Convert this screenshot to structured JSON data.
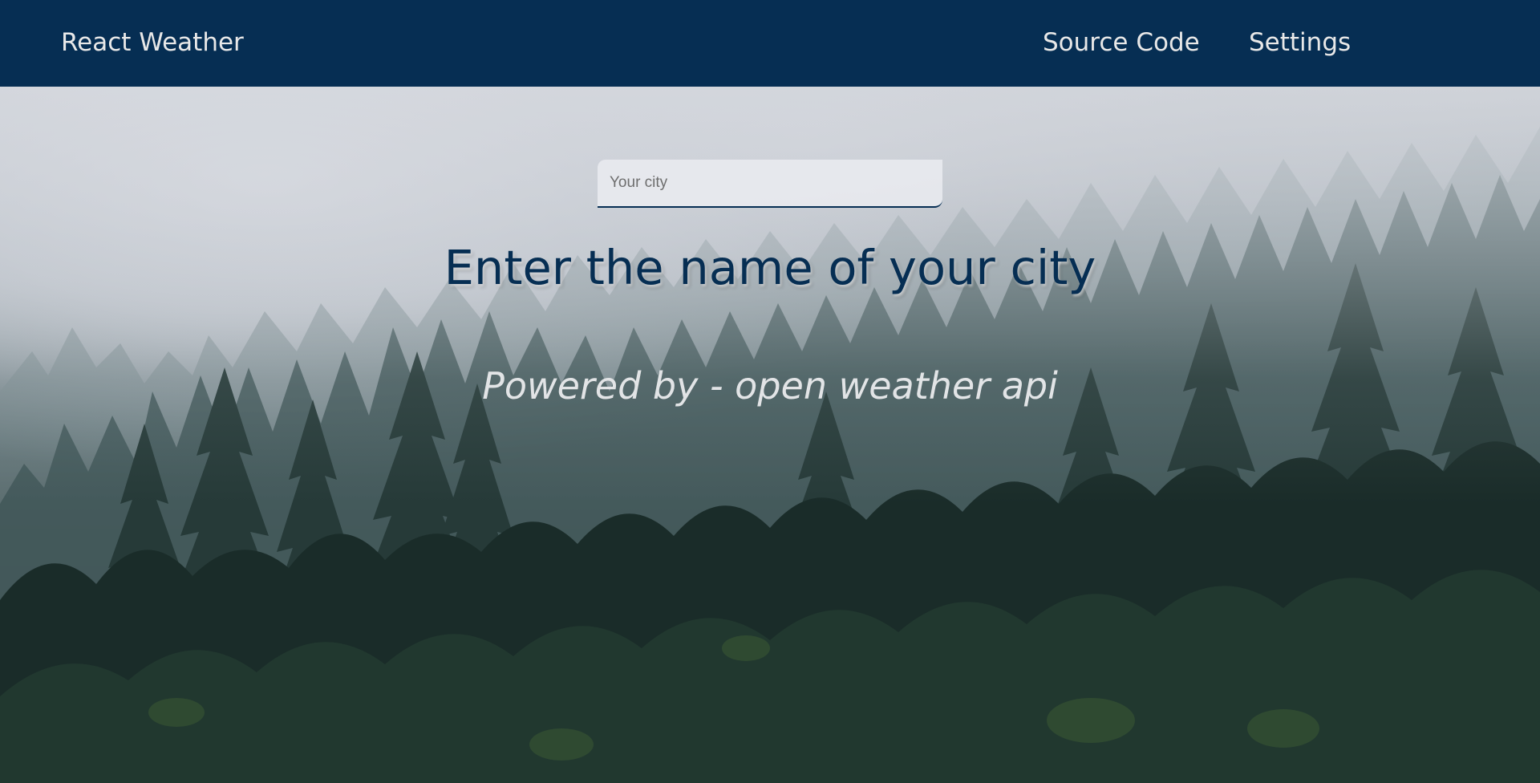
{
  "navbar": {
    "brand": "React Weather",
    "links": [
      {
        "label": "Source Code"
      },
      {
        "label": "Settings"
      }
    ],
    "background_color": "#062e53"
  },
  "search": {
    "placeholder": "Your city",
    "value": ""
  },
  "main": {
    "headline": "Enter the name of your city",
    "powered_by": "Powered by - open weather api"
  },
  "background": {
    "description_icon": "misty-forest-image"
  }
}
